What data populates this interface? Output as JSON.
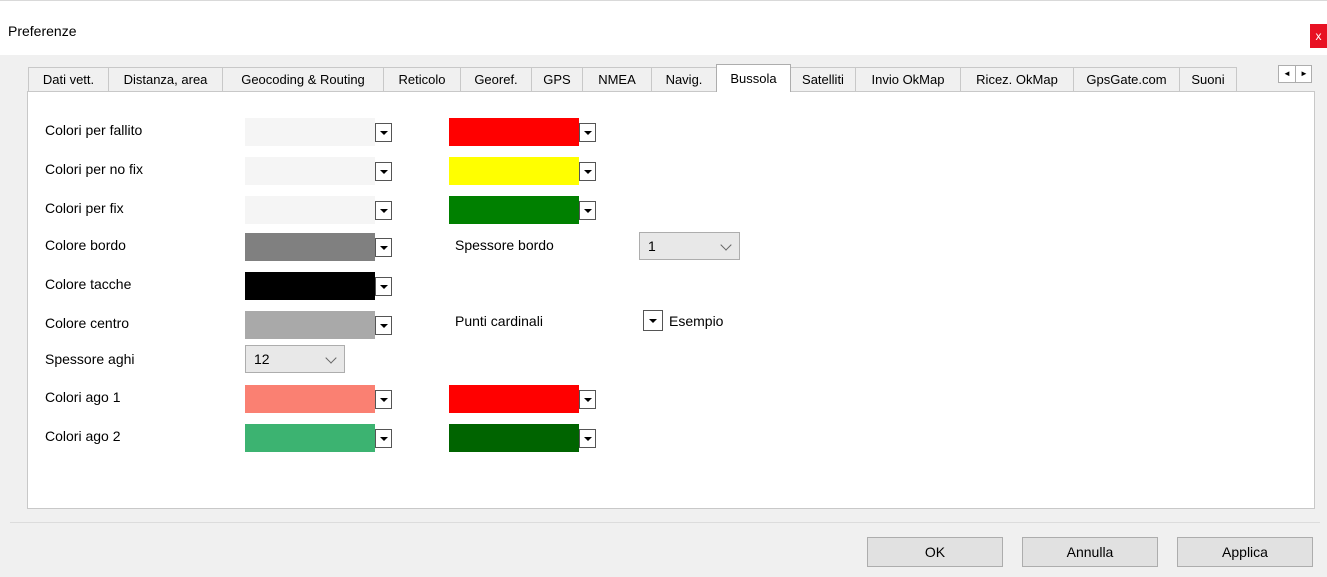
{
  "window": {
    "title": "Preferenze",
    "close_label": "x"
  },
  "tabs": [
    {
      "label": "Dati vett."
    },
    {
      "label": "Distanza, area"
    },
    {
      "label": "Geocoding & Routing"
    },
    {
      "label": "Reticolo"
    },
    {
      "label": "Georef."
    },
    {
      "label": "GPS"
    },
    {
      "label": "NMEA"
    },
    {
      "label": "Navig."
    },
    {
      "label": "Bussola",
      "active": true
    },
    {
      "label": "Satelliti"
    },
    {
      "label": "Invio OkMap"
    },
    {
      "label": "Ricez. OkMap"
    },
    {
      "label": "GpsGate.com"
    },
    {
      "label": "Suoni"
    }
  ],
  "tab_scroll": {
    "left": "◄",
    "right": "►"
  },
  "form": {
    "colori_fallito": {
      "label": "Colori per fallito",
      "color1": "#f5f5f5",
      "color2": "#ff0000"
    },
    "colori_no_fix": {
      "label": "Colori per no fix",
      "color1": "#f5f5f5",
      "color2": "#ffff00"
    },
    "colori_fix": {
      "label": "Colori per fix",
      "color1": "#f5f5f5",
      "color2": "#008000"
    },
    "colore_bordo": {
      "label": "Colore bordo",
      "color": "#808080"
    },
    "spessore_bordo": {
      "label": "Spessore bordo",
      "value": "1"
    },
    "colore_tacche": {
      "label": "Colore tacche",
      "color": "#000000"
    },
    "colore_centro": {
      "label": "Colore centro",
      "color": "#a9a9a9"
    },
    "punti_cardinali": {
      "label": "Punti cardinali",
      "example": "Esempio"
    },
    "spessore_aghi": {
      "label": "Spessore aghi",
      "value": "12"
    },
    "colori_ago1": {
      "label": "Colori ago 1",
      "color1": "#fa8072",
      "color2": "#ff0000"
    },
    "colori_ago2": {
      "label": "Colori ago 2",
      "color1": "#3cb371",
      "color2": "#006400"
    }
  },
  "buttons": {
    "ok": "OK",
    "cancel": "Annulla",
    "apply": "Applica"
  }
}
